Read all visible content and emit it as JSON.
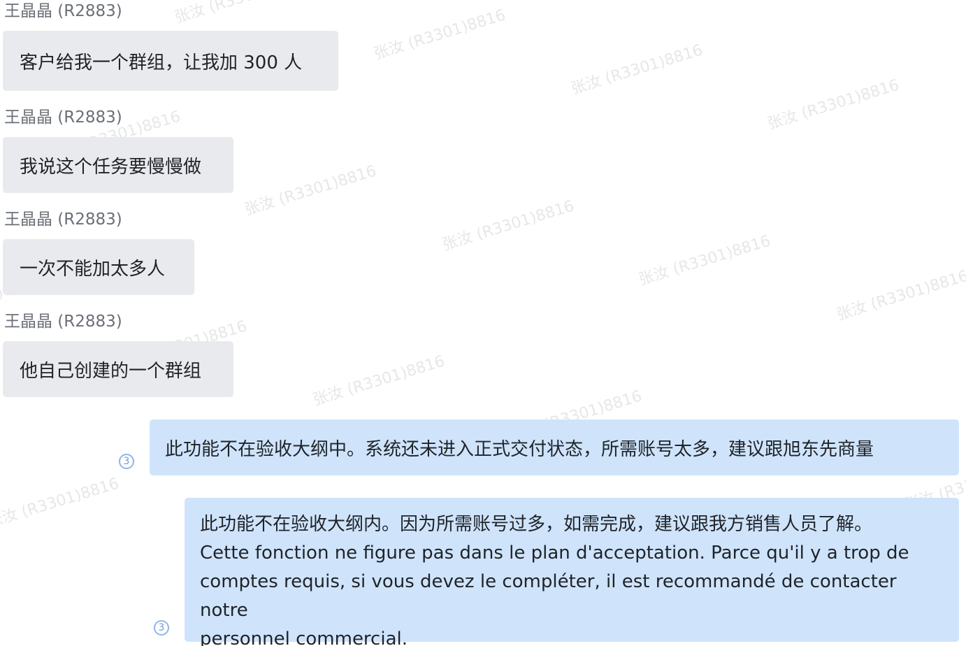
{
  "watermark": "张汝 (R3301)8816",
  "messages": [
    {
      "sender": "王晶晶 (R2883)",
      "text": "客户给我一个群组，让我加 300 人"
    },
    {
      "sender": "王晶晶 (R2883)",
      "text": "我说这个任务要慢慢做"
    },
    {
      "sender": "王晶晶 (R2883)",
      "text": "一次不能加太多人"
    },
    {
      "sender": "王晶晶 (R2883)",
      "text": "他自己创建的一个群组"
    }
  ],
  "replies": [
    {
      "text": "此功能不在验收大纲中。系统还未进入正式交付状态，所需账号太多，建议跟旭东先商量",
      "read_count": "3"
    },
    {
      "lines": [
        "此功能不在验收大纲内。因为所需账号过多，如需完成，建议跟我方销售人员了解。",
        "Cette fonction ne figure pas dans le plan d'acceptation. Parce qu'il y a trop de",
        "comptes requis, si vous devez le compléter, il est recommandé de contacter notre",
        "personnel commercial."
      ],
      "read_count": "3"
    }
  ]
}
